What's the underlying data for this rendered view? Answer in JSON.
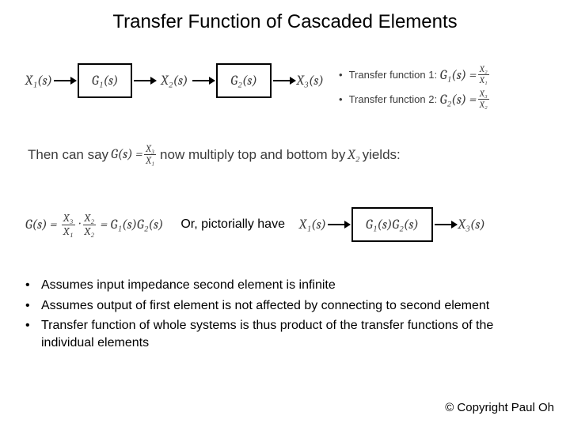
{
  "title": "Transfer Function of Cascaded Elements",
  "diagram1": {
    "x1": "X₁(s)",
    "g1": "G₁(s)",
    "x2": "X₂(s)",
    "g2": "G₂(s)",
    "x3": "X₃(s)"
  },
  "tf_defs": {
    "line1_label": "Transfer function 1:",
    "line1_lhs": "G₁(s) =",
    "line1_num": "X₂",
    "line1_den": "X₁",
    "line2_label": "Transfer function 2:",
    "line2_lhs": "G₂(s) =",
    "line2_num": "X₃",
    "line2_den": "X₂"
  },
  "derivation": {
    "pre": "Then can say ",
    "lhs": "G(s) =",
    "num": "X₃",
    "den": "X₁",
    "mid": " now multiply top and bottom by ",
    "by": "X₂",
    "post": " yields:"
  },
  "result_eq": {
    "lhs": "G(s) =",
    "f1_num": "X₃",
    "f1_den": "X₁",
    "dot": "·",
    "f2_num": "X₂",
    "f2_den": "X₂",
    "rhs": "= G₁(s)G₂(s)"
  },
  "or_label": "Or, pictorially have",
  "diagram2": {
    "x1": "X₁(s)",
    "block": "G₁(s)G₂(s)",
    "x3": "X₃(s)"
  },
  "bullets": [
    "Assumes input impedance second element is infinite",
    "Assumes output of first element is not affected by connecting to second element",
    "Transfer function of whole systems is thus product of the transfer functions of the individual elements"
  ],
  "copyright": "© Copyright Paul Oh"
}
